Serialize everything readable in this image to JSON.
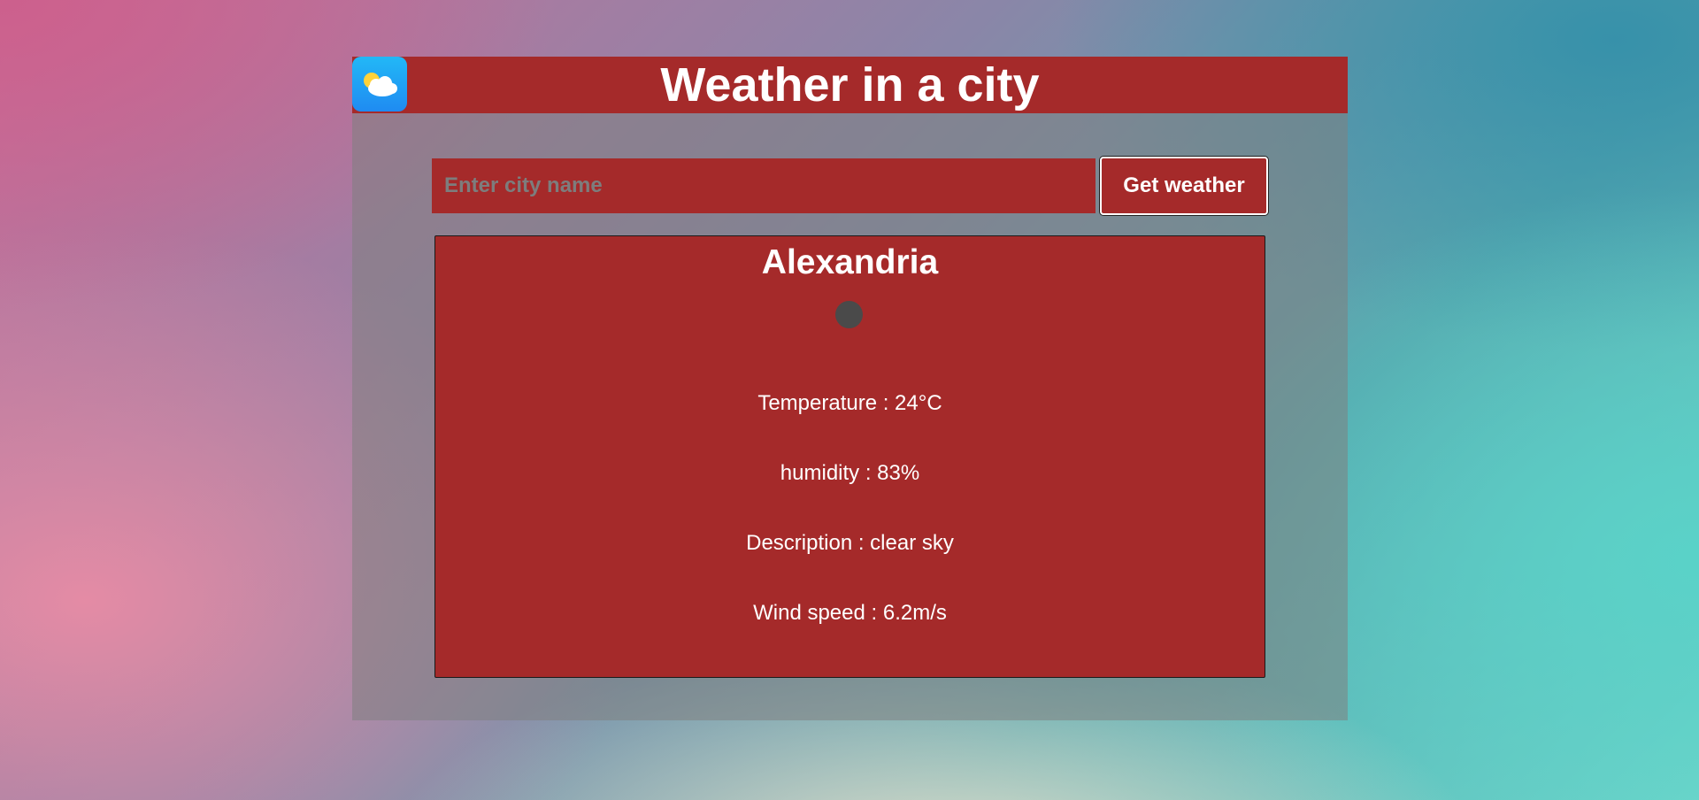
{
  "header": {
    "logo_icon": "weather-app-icon",
    "title": "Weather in a city"
  },
  "search": {
    "placeholder": "Enter city name",
    "value": "",
    "button_label": "Get weather"
  },
  "weather": {
    "city": "Alexandria",
    "icon": "weather-condition-icon",
    "temperature": "Temperature : 24°C",
    "humidity": "humidity : 83%",
    "description": "Description : clear sky",
    "wind_speed": "Wind speed : 6.2m/s"
  },
  "colors": {
    "accent": "#a52a2a",
    "text": "#ffffff",
    "panel": "rgba(128,128,128,0.55)"
  }
}
